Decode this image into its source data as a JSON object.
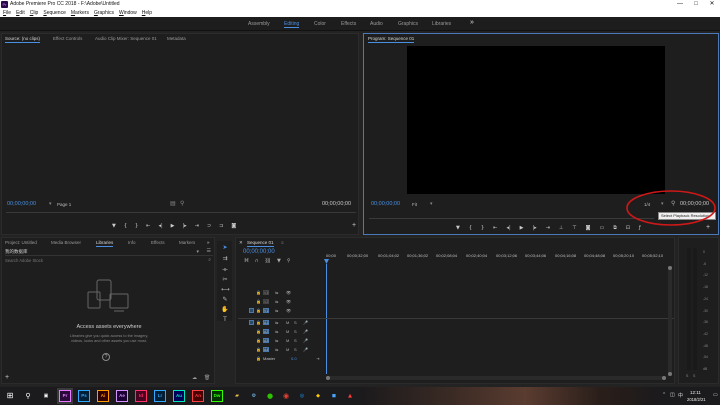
{
  "window": {
    "title": "Adobe Premiere Pro CC 2018 - F:\\Adobe\\Untitled",
    "app_icon": "Pr",
    "controls": [
      "—",
      "□",
      "✕"
    ]
  },
  "menu": [
    "File",
    "Edit",
    "Clip",
    "Sequence",
    "Markers",
    "Graphics",
    "Window",
    "Help"
  ],
  "workspaces": {
    "items": [
      "Assembly",
      "Editing",
      "Color",
      "Effects",
      "Audio",
      "Graphics",
      "Libraries"
    ],
    "active": "Editing",
    "more": "»"
  },
  "source_panel": {
    "tabs": [
      "Source: (no clips)",
      "Effect Controls",
      "Audio Clip Mixer: Sequence 01",
      "Metadata"
    ],
    "timecode_left": "00;00;00;00",
    "page": "Page 1",
    "timecode_right": "00;00;00;00"
  },
  "program_panel": {
    "tab": "Program: Sequence 01",
    "timecode_left": "00;00;00;00",
    "fit": "Fit",
    "resolution": "1/4",
    "timecode_right": "00;00;00;00",
    "tooltip": "Select Playback Resolution"
  },
  "project_panel": {
    "tabs": [
      "Project: Untitled",
      "Media Browser",
      "Libraries",
      "Info",
      "Effects",
      "Markers"
    ],
    "library_select": "我的数据库",
    "search_placeholder": "Search Adobe Stock",
    "heading": "Access assets everywhere",
    "body": "Libraries give you quick access to the imagery, videos, looks and other assets you use most.",
    "help": "?"
  },
  "timeline": {
    "tab": "Sequence 01",
    "timecode": "00;00;00;00",
    "ruler": [
      "00;00",
      "00;00;32;00",
      "00;01;04;02",
      "00;01;36;02",
      "00;02;08;04",
      "00;02;40;04",
      "00;03;12;06",
      "00;03;44;06",
      "00;04;16;08",
      "00;04;48;08",
      "00;05;20;10",
      "00;05;52;10",
      "00;06;24;12",
      "00;06;56;12",
      "00;07;28;14",
      "00;08;00;14"
    ],
    "video_tracks": [
      "V3",
      "V2",
      "V1"
    ],
    "audio_tracks": [
      "A1",
      "A2",
      "A3",
      "A4"
    ],
    "master": {
      "label": "Master",
      "value": "0.0"
    },
    "track_flags": [
      "M",
      "S"
    ]
  },
  "audio_meter": {
    "scale": [
      "0",
      "-6",
      "-12",
      "-18",
      "-24",
      "-30",
      "-36",
      "-42",
      "-48",
      "-54",
      "dB"
    ],
    "channels": [
      "S",
      "S"
    ]
  },
  "taskbar": {
    "apps": [
      "Pr",
      "Ps",
      "Ai",
      "Ae",
      "Id",
      "Lr",
      "Au",
      "An",
      "Dw"
    ],
    "clock_time": "12:11",
    "clock_date": "2018/2/21",
    "ime": "中"
  },
  "colors": {
    "accent": "#4a90e2",
    "annotation": "#d01818",
    "background": "#232323"
  }
}
